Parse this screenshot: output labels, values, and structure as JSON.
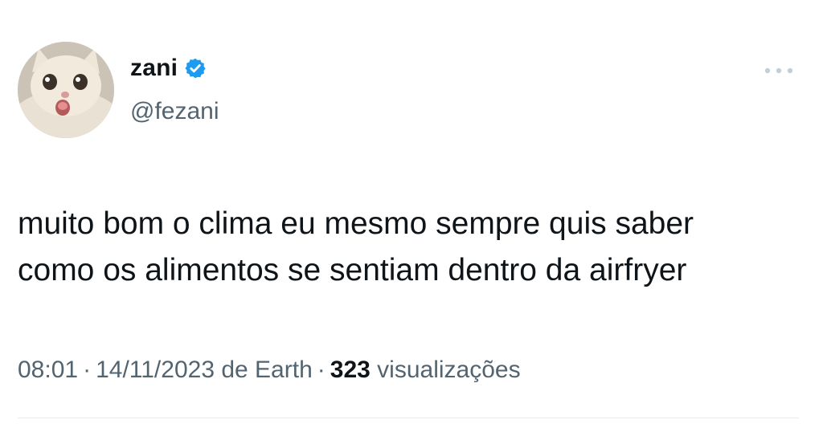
{
  "author": {
    "display_name": "zani",
    "handle": "@fezani",
    "verified": true,
    "avatar_icon": "cat-avatar"
  },
  "tweet": {
    "text_line1": "muito bom o clima eu mesmo sempre quis saber",
    "text_line2": "como os alimentos se sentiam dentro da airfryer"
  },
  "meta": {
    "time": "08:01",
    "date": "14/11/2023",
    "source": "de Earth",
    "separator": "·",
    "views_count": "323",
    "views_label": "visualizações"
  },
  "icons": {
    "verified": "verified-badge-icon",
    "more": "more-options-icon"
  },
  "colors": {
    "verified_blue": "#1d9bf0",
    "text_primary": "#0f1419",
    "text_secondary": "#536471"
  }
}
